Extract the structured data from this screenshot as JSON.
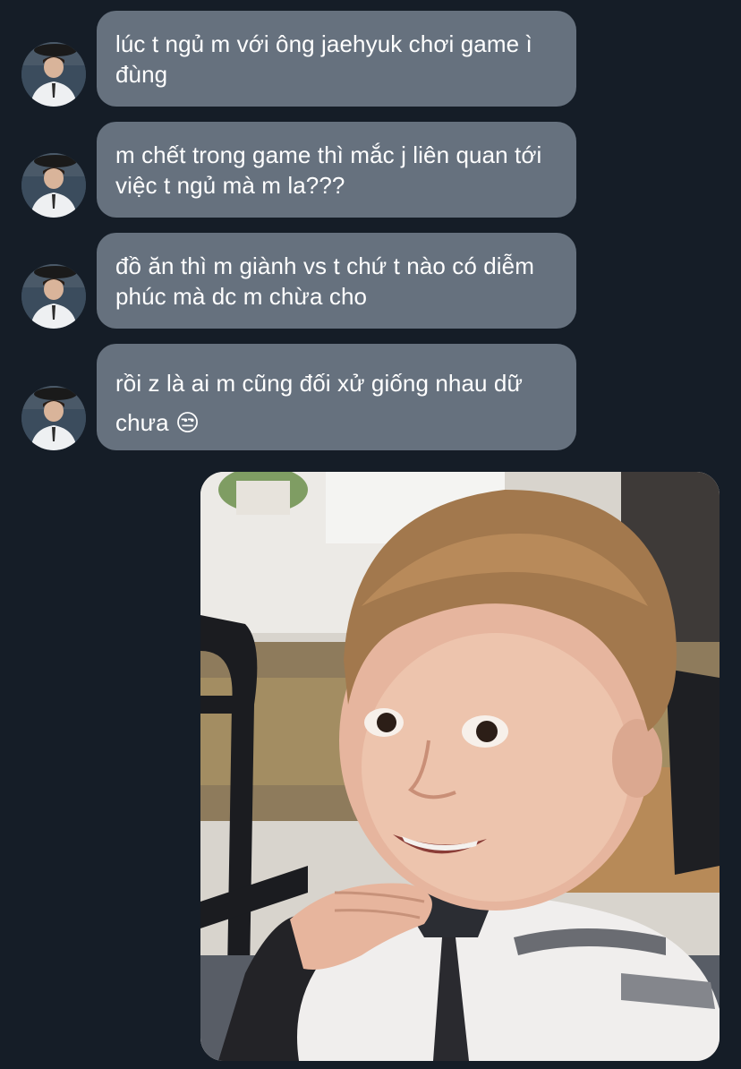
{
  "conversation": {
    "messages": [
      {
        "text": "lúc t ngủ m với ông jaehyuk chơi game ì đùng"
      },
      {
        "text": "m chết trong game thì mắc j liên quan tới việc t ngủ mà m la???"
      },
      {
        "text": "đồ ăn thì m giành vs t chứ t nào có diễm phúc mà dc m chừa cho"
      },
      {
        "text": "rồi z là ai m cũng đối xử giống nhau dữ chưa 😒"
      }
    ]
  },
  "colors": {
    "background": "#151d27",
    "bubble": "#66717e",
    "text": "#ffffff"
  },
  "icons": {
    "avatar": "avatar-photo",
    "attachment": "sent-photo-child-smiling"
  }
}
